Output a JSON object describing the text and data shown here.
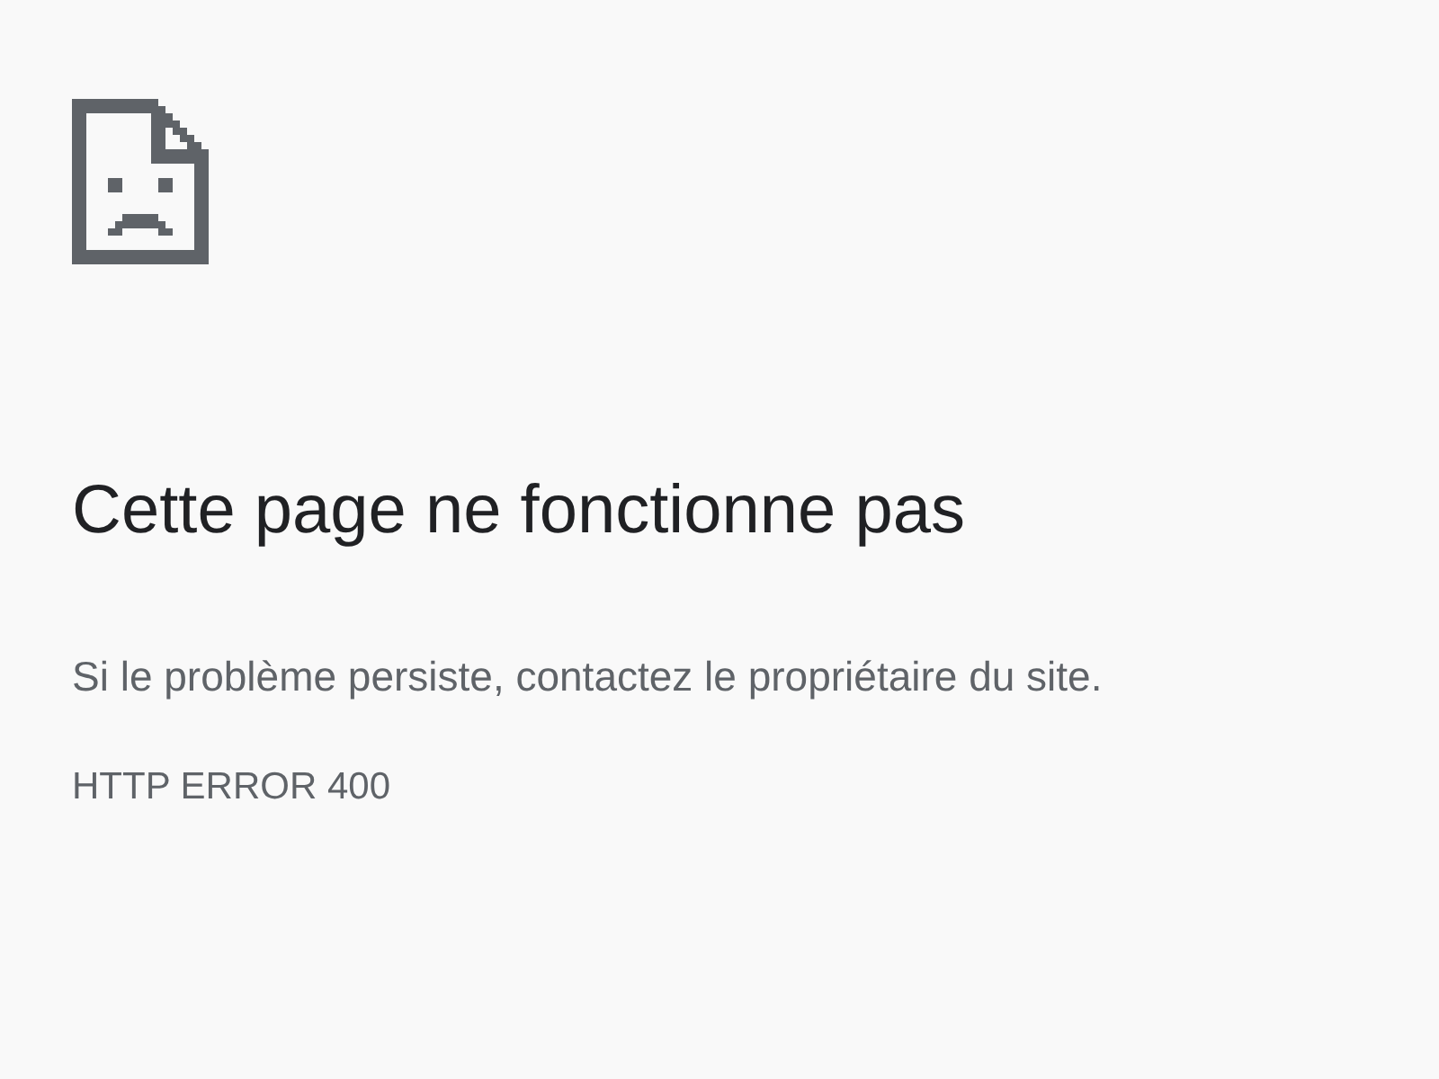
{
  "heading": "Cette page ne fonctionne pas",
  "message": "Si le problème persiste, contactez le propriétaire du site.",
  "error_code": "HTTP ERROR 400"
}
